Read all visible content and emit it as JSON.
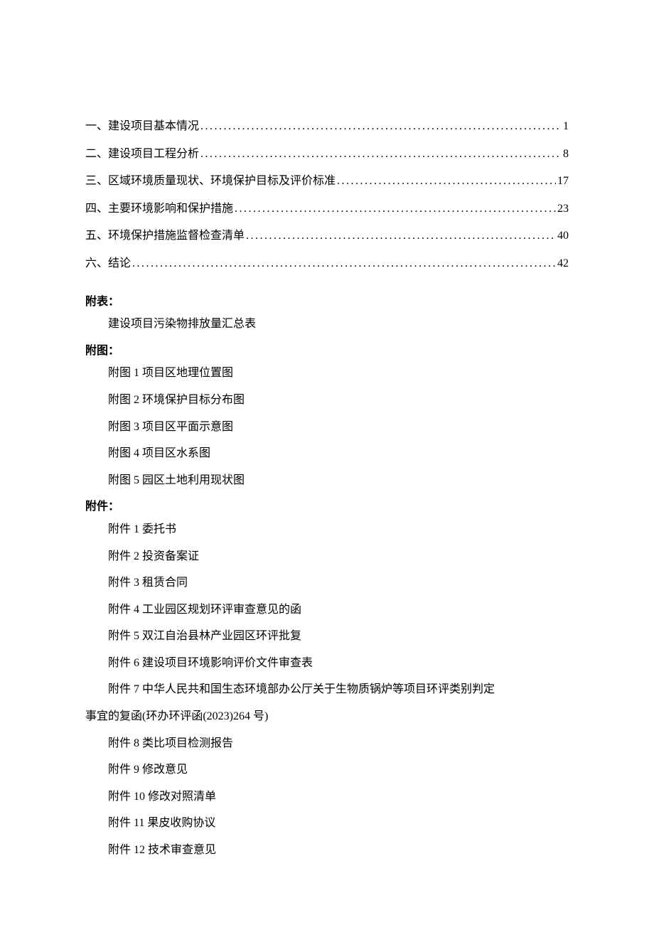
{
  "toc": [
    {
      "label": "一、建设项目基本情况",
      "page": "1"
    },
    {
      "label": "二、建设项目工程分析",
      "page": "8"
    },
    {
      "label": "三、区域环境质量现状、环境保护目标及评价标准",
      "page": "17"
    },
    {
      "label": "四、主要环境影响和保护措施",
      "page": "23"
    },
    {
      "label": "五、环境保护措施监督检查清单",
      "page": "40"
    },
    {
      "label": "六、结论",
      "page": "42"
    }
  ],
  "sections": {
    "fubiao": {
      "heading": "附表：",
      "items": [
        "建设项目污染物排放量汇总表"
      ]
    },
    "futu": {
      "heading": "附图：",
      "items": [
        "附图 1 项目区地理位置图",
        "附图 2 环境保护目标分布图",
        "附图 3 项目区平面示意图",
        "附图 4 项目区水系图",
        "附图 5 园区土地利用现状图"
      ]
    },
    "fujian": {
      "heading": "附件：",
      "items": [
        "附件 1 委托书",
        "附件 2 投资备案证",
        "附件 3 租赁合同",
        "附件 4 工业园区规划环评审查意见的函",
        "附件 5 双江自治县林产业园区环评批复",
        "附件 6 建设项目环境影响评价文件审查表"
      ],
      "wrap_first": "附件 7 中华人民共和国生态环境部办公厅关于生物质锅炉等项目环评类别判定",
      "wrap_second": "事宜的复函(环办环评函(2023)264 号)",
      "items_after": [
        "附件 8 类比项目检测报告",
        "附件 9 修改意见",
        "附件 10 修改对照清单",
        "附件 11 果皮收购协议",
        "附件 12 技术审查意见"
      ]
    }
  }
}
